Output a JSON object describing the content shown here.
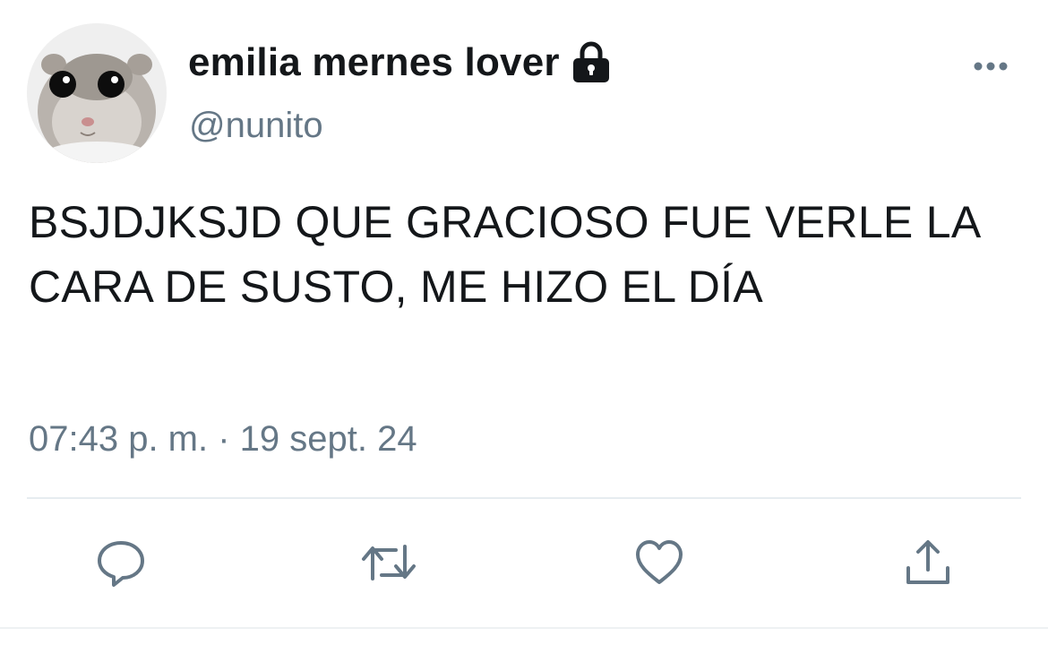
{
  "user": {
    "display_name": "emilia mernes lover",
    "handle": "@nunito",
    "protected_icon": "lock-icon",
    "avatar_icon": "hamster-avatar"
  },
  "tweet": {
    "text": "BSJDJKSJD QUE GRACIOSO FUE VERLE LA CARA DE SUSTO, ME HIZO EL DÍA",
    "timestamp": "07:43 p. m. · 19 sept. 24"
  },
  "actions": [
    {
      "icon": "reply-icon"
    },
    {
      "icon": "retweet-icon"
    },
    {
      "icon": "like-icon"
    },
    {
      "icon": "share-icon"
    }
  ],
  "menu_icon": "more-options-icon",
  "colors": {
    "text": "#14171a",
    "secondary": "#657786",
    "divider": "#e6ecf0"
  }
}
